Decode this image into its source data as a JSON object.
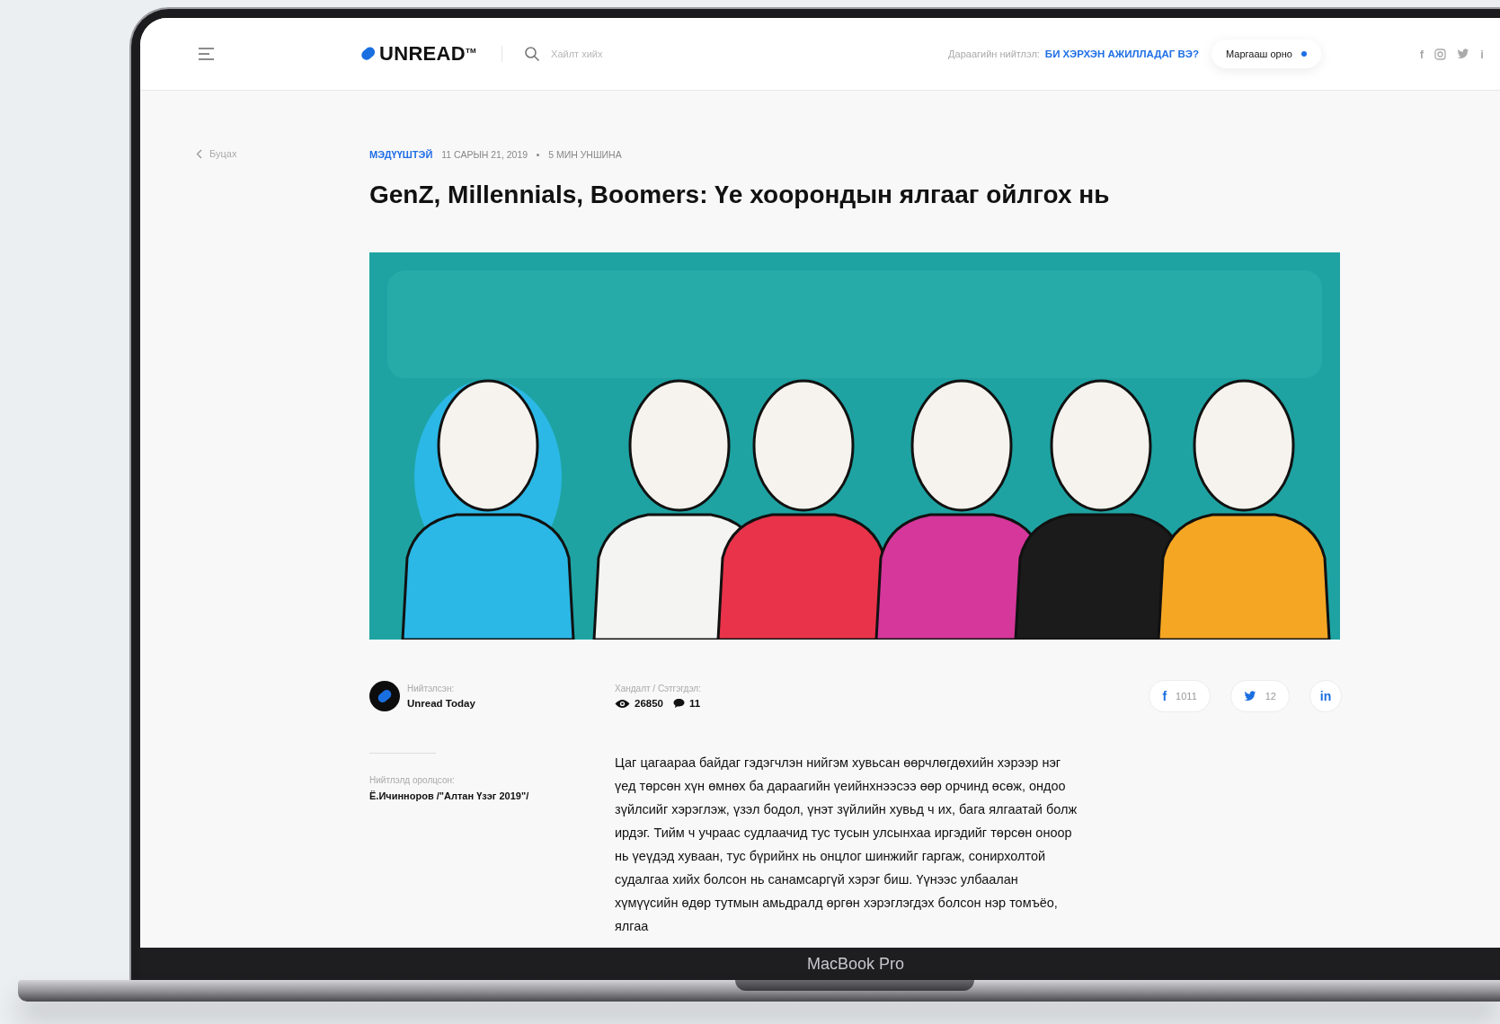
{
  "header": {
    "logo": "UNREAD$^{TM}$",
    "search": {
      "placeholder": "Хайлт хийх"
    },
    "next_label": "Дараагийн нийтлэл:",
    "next_link": "БИ ХЭРХЭН АЖИЛЛАДАГ ВЭ?",
    "tomorrow_button": "Маргааш орно",
    "social": [
      {
        "kind": "glyph",
        "text": "f"
      },
      {
        "kind": "instagram"
      },
      {
        "kind": "twitter"
      },
      {
        "kind": "glyph",
        "text": "i"
      }
    ]
  },
  "back": "Буцах",
  "article": {
    "category": "МЭДҮҮШТЭЙ",
    "date": "11 САРЫН 21, 2019",
    "read_time": "5 МИН УНШИНА",
    "title": "GenZ, Millennials, Boomers: Үе хоорондын ялгааг ойлгох нь"
  },
  "author": {
    "label": "Нийтэлсэн:",
    "name": "Unread Today"
  },
  "stats": {
    "label": "Хандалт / Сэтгэгдэл:",
    "views": "26850",
    "comments": "11"
  },
  "shares": [
    {
      "kind": "facebook",
      "glyph": "f",
      "count": "1011"
    },
    {
      "kind": "twitter",
      "count": "12"
    },
    {
      "kind": "linkedin",
      "glyph": "in"
    }
  ],
  "contributors": {
    "label": "Нийтлэлд оролцсон:",
    "name": "Ё.Ичинноров /\"Алтан Үзэг 2019\"/"
  },
  "body": "Цаг цагаараа байдаг гэдэгчлэн нийгэм хувьсан өөрчлөгдөхийн хэрээр нэг үед төрсөн хүн өмнөх ба дараагийн үеийнхнээсээ өөр орчинд өсөж, ондоо зүйлсийг хэрэглэж, үзэл бодол, үнэт зүйлийн хувьд ч их, бага ялгаатай болж ирдэг. Тийм ч учраас судлаачид тус тусын улсынхаа иргэдийг төрсөн оноор нь үеүдэд хуваан, тус бүрийнх нь онцлог шинжийг гаргаж, сонирхолтой судалгаа хийх болсон нь санамсаргүй хэрэг биш. Үүнээс улбаалан хүмүүсийн өдөр тутмын амьдралд өргөн хэрэглэгдэх болсон нэр томъёо, ялгаа",
  "device": {
    "label": "MacBook Pro"
  }
}
